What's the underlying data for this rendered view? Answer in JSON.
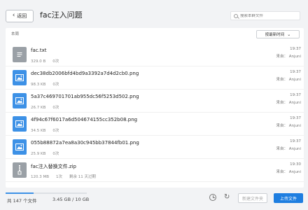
{
  "header": {
    "back_label": "返回",
    "title": "fac汪入问题",
    "search_placeholder": "搜索本群文件"
  },
  "list": {
    "label": "本周",
    "sort_label": "按最新时间"
  },
  "files": [
    {
      "name": "fac.txt",
      "size": "329.0 B",
      "downloads": "0次",
      "extra": "",
      "time": "19:37",
      "owner": "来自： Anjuni",
      "icon": "document-icon"
    },
    {
      "name": "dec38db2006bfd4bd9a3392a7d4d2cb0.png",
      "size": "98.3 KB",
      "downloads": "0次",
      "extra": "",
      "time": "19:37",
      "owner": "来自： Anjuni",
      "icon": "image-icon"
    },
    {
      "name": "5a37c469701701ab955dc56f5253d502.png",
      "size": "26.7 KB",
      "downloads": "0次",
      "extra": "",
      "time": "19:37",
      "owner": "来自： Anjuni",
      "icon": "image-icon"
    },
    {
      "name": "4f94c67f6017a6d504674155cc352b08.png",
      "size": "34.5 KB",
      "downloads": "0次",
      "extra": "",
      "time": "19:37",
      "owner": "来自： Anjuni",
      "icon": "image-icon"
    },
    {
      "name": "055b88872a7ea8a30c945bb37844fb01.png",
      "size": "25.9 KB",
      "downloads": "0次",
      "extra": "",
      "time": "19:37",
      "owner": "来自： Anjuni",
      "icon": "image-icon"
    },
    {
      "name": "fac注入替换文件.zip",
      "size": "120.3 MB",
      "downloads": "1次",
      "extra": "剩余 11 天过期",
      "time": "19:30",
      "owner": "来自： Anjuni",
      "icon": "zip-icon"
    }
  ],
  "status": {
    "file_count": "共 147 个文件",
    "usage": "3.45 GB / 10 GB",
    "usage_fraction": 0.345,
    "new_folder_label": "新建文件夹",
    "upload_label": "上传文件"
  },
  "colors": {
    "accent": "#1e7ee0",
    "image_icon": "#3d91e6",
    "document_icon": "#9aa0a6"
  }
}
